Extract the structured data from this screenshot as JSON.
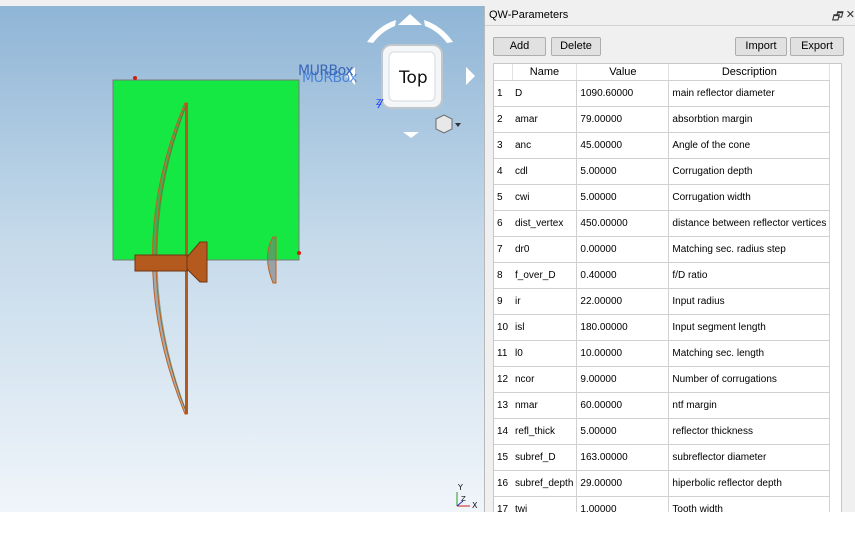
{
  "viewport": {
    "cube_label": "Top",
    "object_label_front": "MURBox",
    "object_label_back": "MURBox",
    "axis_y": "Y",
    "axis_x": "X",
    "axis_z": "Z",
    "cube_axis_z": "Z",
    "colors": {
      "box": "#16e843",
      "copper": "#b45a1e"
    }
  },
  "panel": {
    "title": "QW-Parameters",
    "add_label": "Add",
    "delete_label": "Delete",
    "import_label": "Import",
    "export_label": "Export",
    "columns": [
      "Name",
      "Value",
      "Description"
    ],
    "rows": [
      {
        "idx": "1",
        "name": "D",
        "value": "1090.60000",
        "desc": "main reflector diameter"
      },
      {
        "idx": "2",
        "name": "amar",
        "value": "79.00000",
        "desc": "absorbtion margin"
      },
      {
        "idx": "3",
        "name": "anc",
        "value": "45.00000",
        "desc": "Angle of the cone"
      },
      {
        "idx": "4",
        "name": "cdl",
        "value": "5.00000",
        "desc": "Corrugation depth"
      },
      {
        "idx": "5",
        "name": "cwi",
        "value": "5.00000",
        "desc": "Corrugation width"
      },
      {
        "idx": "6",
        "name": "dist_vertex",
        "value": "450.00000",
        "desc": "distance between reflector vertices"
      },
      {
        "idx": "7",
        "name": "dr0",
        "value": "0.00000",
        "desc": "Matching sec. radius step"
      },
      {
        "idx": "8",
        "name": "f_over_D",
        "value": "0.40000",
        "desc": "f/D ratio"
      },
      {
        "idx": "9",
        "name": "ir",
        "value": "22.00000",
        "desc": "Input radius"
      },
      {
        "idx": "10",
        "name": "isl",
        "value": "180.00000",
        "desc": "Input segment length"
      },
      {
        "idx": "11",
        "name": "l0",
        "value": "10.00000",
        "desc": "Matching sec. length"
      },
      {
        "idx": "12",
        "name": "ncor",
        "value": "9.00000",
        "desc": "Number of corrugations"
      },
      {
        "idx": "13",
        "name": "nmar",
        "value": "60.00000",
        "desc": "ntf margin"
      },
      {
        "idx": "14",
        "name": "refl_thick",
        "value": "5.00000",
        "desc": "reflector thickness"
      },
      {
        "idx": "15",
        "name": "subref_D",
        "value": "163.00000",
        "desc": "subreflector diameter"
      },
      {
        "idx": "16",
        "name": "subref_depth",
        "value": "29.00000",
        "desc": "hiperbolic reflector depth"
      },
      {
        "idx": "17",
        "name": "twi",
        "value": "1.00000",
        "desc": "Tooth width"
      }
    ]
  }
}
